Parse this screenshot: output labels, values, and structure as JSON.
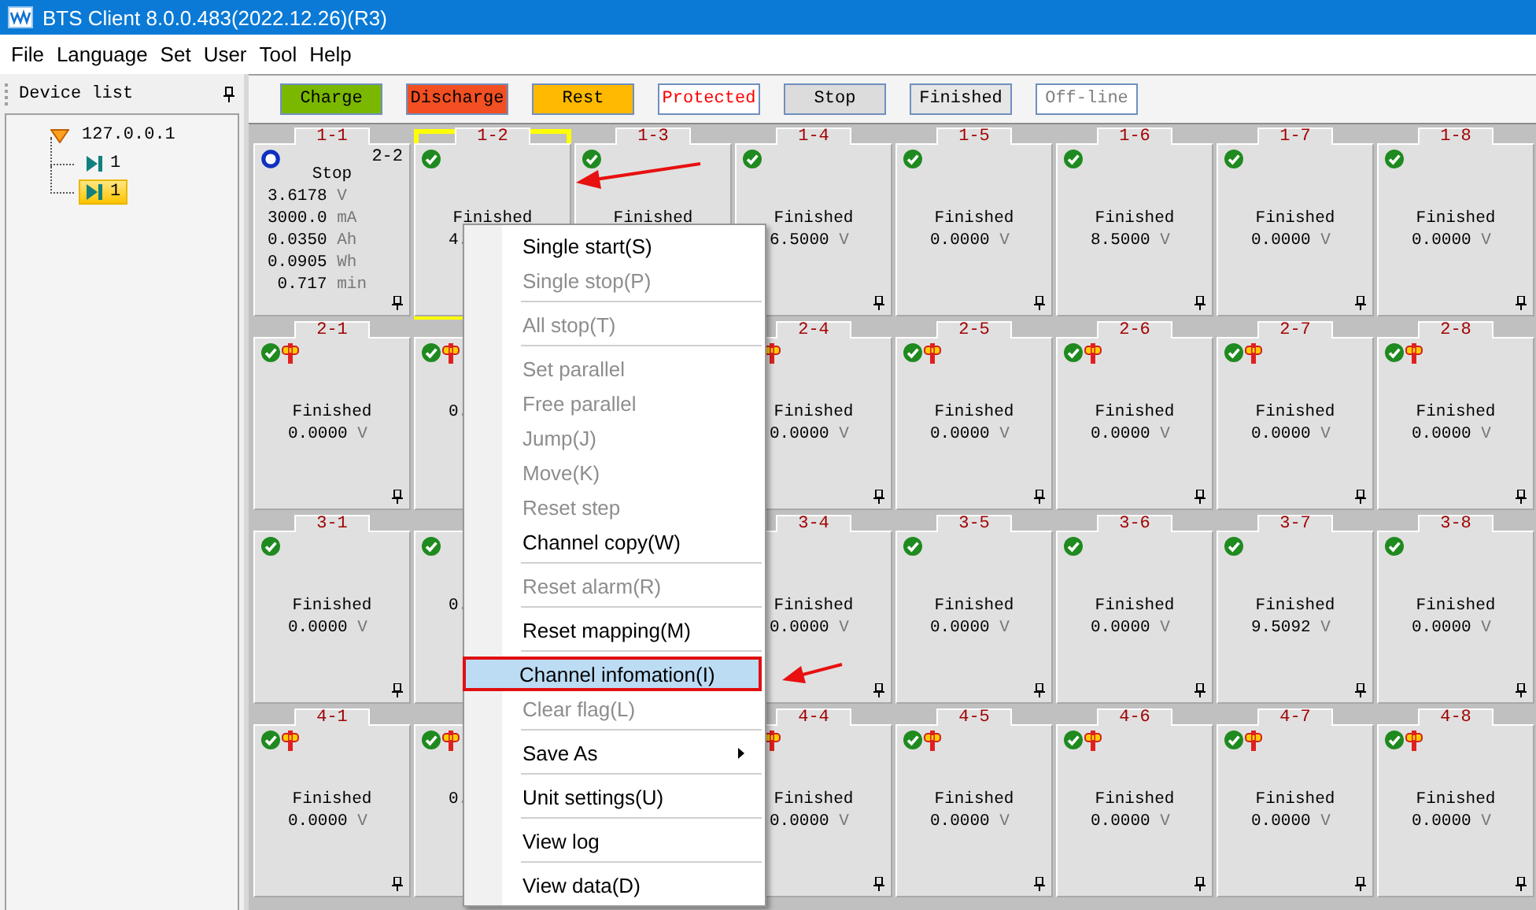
{
  "window": {
    "title": "BTS Client 8.0.0.483(2022.12.26)(R3)"
  },
  "menu_bar": [
    "File",
    "Language",
    "Set",
    "User",
    "Tool",
    "Help"
  ],
  "device_panel": {
    "title": "Device list",
    "tree": [
      {
        "label": "127.0.0.1",
        "expanded": true,
        "selected": false,
        "children": [
          {
            "label": "1",
            "selected": false
          },
          {
            "label": "1",
            "selected": true
          }
        ]
      }
    ]
  },
  "legend": [
    {
      "label": "Charge",
      "kind": "fill",
      "color": "#7ab800"
    },
    {
      "label": "Discharge",
      "kind": "fill",
      "color": "#f25022"
    },
    {
      "label": "Rest",
      "kind": "fill",
      "color": "#ffb900"
    },
    {
      "label": "Protected",
      "kind": "outline",
      "color": "#ff0000"
    },
    {
      "label": "Stop",
      "kind": "fill",
      "color": "#dcdcdc"
    },
    {
      "label": "Finished",
      "kind": "fill",
      "color": "#e6e6e6"
    },
    {
      "label": "Off-line",
      "kind": "outline",
      "color": "#808080"
    }
  ],
  "rows": [
    {
      "cells": [
        {
          "label": "1-1",
          "selected": false,
          "kind": "stopped",
          "plugged": false,
          "badge": "2-2",
          "status": "Stop",
          "readings": [
            {
              "value": "3.6178",
              "unit": "V"
            },
            {
              "value": "3000.0",
              "unit": "mA"
            },
            {
              "value": "0.0350",
              "unit": "Ah"
            },
            {
              "value": "0.0905",
              "unit": "Wh"
            },
            {
              "value": "0.717",
              "unit": "min"
            }
          ],
          "pin": true
        },
        {
          "label": "1-2",
          "selected": true,
          "kind": "finished",
          "plugged": false,
          "status": "Finished",
          "readings": [
            {
              "value": "4."
            }
          ]
        },
        {
          "label": "1-3",
          "selected": false,
          "kind": "finished",
          "plugged": false,
          "status": "Finished"
        },
        {
          "label": "1-4",
          "selected": false,
          "kind": "finished",
          "plugged": false,
          "status": "Finished",
          "readings": [
            {
              "value": "6.5000",
              "unit": "V"
            }
          ],
          "pin": true
        },
        {
          "label": "1-5",
          "selected": false,
          "kind": "finished",
          "plugged": false,
          "status": "Finished",
          "readings": [
            {
              "value": "0.0000",
              "unit": "V"
            }
          ],
          "pin": true
        },
        {
          "label": "1-6",
          "selected": false,
          "kind": "finished",
          "plugged": false,
          "status": "Finished",
          "readings": [
            {
              "value": "8.5000",
              "unit": "V"
            }
          ],
          "pin": true
        },
        {
          "label": "1-7",
          "selected": false,
          "kind": "finished",
          "plugged": false,
          "status": "Finished",
          "readings": [
            {
              "value": "0.0000",
              "unit": "V"
            }
          ],
          "pin": true
        },
        {
          "label": "1-8",
          "selected": false,
          "kind": "finished",
          "plugged": false,
          "status": "Finished",
          "readings": [
            {
              "value": "0.0000",
              "unit": "V"
            }
          ],
          "pin": true
        }
      ]
    },
    {
      "cells": [
        {
          "label": "2-1",
          "selected": false,
          "kind": "finished",
          "plugged": true,
          "status": "Finished",
          "readings": [
            {
              "value": "0.0000",
              "unit": "V"
            }
          ],
          "pin": true
        },
        {
          "selected": false,
          "kind": "finished",
          "plugged": true,
          "readings": [
            {
              "value": "0."
            }
          ]
        },
        {},
        {
          "label": "2-4",
          "selected": false,
          "plugged": true,
          "status": "Finished",
          "readings": [
            {
              "value": "0.0000",
              "unit": "V"
            }
          ],
          "pin": true
        },
        {
          "label": "2-5",
          "selected": false,
          "kind": "finished",
          "plugged": true,
          "status": "Finished",
          "readings": [
            {
              "value": "0.0000",
              "unit": "V"
            }
          ],
          "pin": true
        },
        {
          "label": "2-6",
          "selected": false,
          "kind": "finished",
          "plugged": true,
          "status": "Finished",
          "readings": [
            {
              "value": "0.0000",
              "unit": "V"
            }
          ],
          "pin": true
        },
        {
          "label": "2-7",
          "selected": false,
          "kind": "finished",
          "plugged": true,
          "status": "Finished",
          "readings": [
            {
              "value": "0.0000",
              "unit": "V"
            }
          ],
          "pin": true
        },
        {
          "label": "2-8",
          "selected": false,
          "kind": "finished",
          "plugged": true,
          "status": "Finished",
          "readings": [
            {
              "value": "0.0000",
              "unit": "V"
            }
          ],
          "pin": true
        }
      ]
    },
    {
      "cells": [
        {
          "label": "3-1",
          "selected": false,
          "kind": "finished",
          "plugged": false,
          "status": "Finished",
          "readings": [
            {
              "value": "0.0000",
              "unit": "V"
            }
          ],
          "pin": true
        },
        {
          "selected": false,
          "kind": "finished",
          "plugged": false,
          "readings": [
            {
              "value": "0."
            }
          ]
        },
        {},
        {
          "label": "3-4",
          "selected": false,
          "plugged": false,
          "status": "Finished",
          "readings": [
            {
              "value": "0.0000",
              "unit": "V"
            }
          ],
          "pin": true
        },
        {
          "label": "3-5",
          "selected": false,
          "kind": "finished",
          "plugged": false,
          "status": "Finished",
          "readings": [
            {
              "value": "0.0000",
              "unit": "V"
            }
          ],
          "pin": true
        },
        {
          "label": "3-6",
          "selected": false,
          "kind": "finished",
          "plugged": false,
          "status": "Finished",
          "readings": [
            {
              "value": "0.0000",
              "unit": "V"
            }
          ],
          "pin": true
        },
        {
          "label": "3-7",
          "selected": false,
          "kind": "finished",
          "plugged": false,
          "status": "Finished",
          "readings": [
            {
              "value": "9.5092",
              "unit": "V"
            }
          ],
          "pin": true
        },
        {
          "label": "3-8",
          "selected": false,
          "kind": "finished",
          "plugged": false,
          "status": "Finished",
          "readings": [
            {
              "value": "0.0000",
              "unit": "V"
            }
          ],
          "pin": true
        }
      ]
    },
    {
      "cells": [
        {
          "label": "4-1",
          "selected": false,
          "kind": "finished",
          "plugged": true,
          "status": "Finished",
          "readings": [
            {
              "value": "0.0000",
              "unit": "V"
            }
          ],
          "pin": true
        },
        {
          "selected": false,
          "kind": "finished",
          "plugged": true,
          "readings": [
            {
              "value": "0."
            }
          ]
        },
        {},
        {
          "label": "4-4",
          "selected": false,
          "plugged": true,
          "status": "Finished",
          "readings": [
            {
              "value": "0.0000",
              "unit": "V"
            }
          ],
          "pin": true
        },
        {
          "label": "4-5",
          "selected": false,
          "kind": "finished",
          "plugged": true,
          "status": "Finished",
          "readings": [
            {
              "value": "0.0000",
              "unit": "V"
            }
          ],
          "pin": true
        },
        {
          "label": "4-6",
          "selected": false,
          "kind": "finished",
          "plugged": true,
          "status": "Finished",
          "readings": [
            {
              "value": "0.0000",
              "unit": "V"
            }
          ],
          "pin": true
        },
        {
          "label": "4-7",
          "selected": false,
          "kind": "finished",
          "plugged": true,
          "status": "Finished",
          "readings": [
            {
              "value": "0.0000",
              "unit": "V"
            }
          ],
          "pin": true
        },
        {
          "label": "4-8",
          "selected": false,
          "kind": "finished",
          "plugged": true,
          "status": "Finished",
          "readings": [
            {
              "value": "0.0000",
              "unit": "V"
            }
          ],
          "pin": true
        }
      ]
    }
  ],
  "context_menu": [
    {
      "kind": "item",
      "label": "Single start(S)",
      "disabled": false,
      "selected": false
    },
    {
      "kind": "item",
      "label": "Single stop(P)",
      "disabled": true,
      "selected": false
    },
    {
      "kind": "separator"
    },
    {
      "kind": "item",
      "label": "All stop(T)",
      "disabled": true,
      "selected": false
    },
    {
      "kind": "separator"
    },
    {
      "kind": "item",
      "label": "Set parallel",
      "disabled": true,
      "selected": false
    },
    {
      "kind": "item",
      "label": "Free parallel",
      "disabled": true,
      "selected": false
    },
    {
      "kind": "item",
      "label": "Jump(J)",
      "disabled": true,
      "selected": false
    },
    {
      "kind": "item",
      "label": "Move(K)",
      "disabled": true,
      "selected": false
    },
    {
      "kind": "item",
      "label": "Reset step",
      "disabled": true,
      "selected": false
    },
    {
      "kind": "item",
      "label": "Channel copy(W)",
      "disabled": false,
      "selected": false
    },
    {
      "kind": "separator"
    },
    {
      "kind": "item",
      "label": "Reset alarm(R)",
      "disabled": true,
      "selected": false
    },
    {
      "kind": "separator"
    },
    {
      "kind": "item",
      "label": "Reset mapping(M)",
      "disabled": false,
      "selected": false
    },
    {
      "kind": "separator"
    },
    {
      "kind": "item",
      "label": "Channel infomation(I)",
      "disabled": false,
      "selected": true,
      "annotated": true
    },
    {
      "kind": "item",
      "label": "Clear flag(L)",
      "disabled": true,
      "selected": false
    },
    {
      "kind": "separator"
    },
    {
      "kind": "item",
      "label": "Save As",
      "disabled": false,
      "selected": false,
      "submenu": true
    },
    {
      "kind": "separator"
    },
    {
      "kind": "item",
      "label": "Unit settings(U)",
      "disabled": false,
      "selected": false
    },
    {
      "kind": "separator"
    },
    {
      "kind": "item",
      "label": "View log",
      "disabled": false,
      "selected": false
    },
    {
      "kind": "separator"
    },
    {
      "kind": "item",
      "label": "View data(D)",
      "disabled": false,
      "selected": false
    }
  ]
}
